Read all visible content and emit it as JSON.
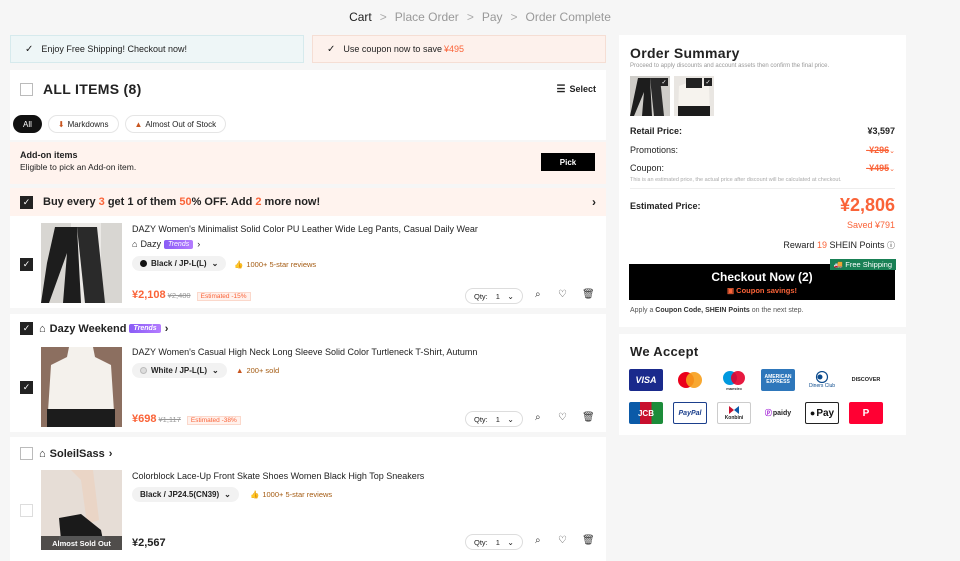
{
  "breadcrumb": [
    "Cart",
    "Place Order",
    "Pay",
    "Order Complete"
  ],
  "banners": {
    "shipping": "Enjoy Free Shipping! Checkout now!",
    "coupon_text": "Use coupon now to save",
    "coupon_amount": "¥495"
  },
  "cart": {
    "title": "ALL ITEMS (8)",
    "select_label": "Select",
    "filters": [
      "All",
      "Markdowns",
      "Almost Out of Stock"
    ],
    "addon": {
      "title": "Add-on items",
      "desc": "Eligible to pick an Add-on item.",
      "button": "Pick"
    },
    "promo": {
      "p1": "Buy every ",
      "n1": "3",
      "p2": " get 1 of them ",
      "n2": "50",
      "p3": "% OFF. Add ",
      "n3": "2",
      "p4": " more now!"
    },
    "items": [
      {
        "name": "DAZY Women's Minimalist Solid Color PU Leather Wide Leg Pants, Casual Daily Wear",
        "store": "Dazy",
        "trends": "Trends",
        "attr": "Black / JP-L(L)",
        "badge": "1000+ 5-star reviews",
        "price": "¥2,108",
        "old": "¥2,480",
        "est": "Estimated -15%",
        "qty_label": "Qty:",
        "qty": "1"
      },
      {
        "store_header": "Dazy Weekend",
        "trends": "Trends",
        "name": "DAZY Women's Casual High Neck Long Sleeve Solid Color Turtleneck T-Shirt, Autumn",
        "attr": "White / JP-L(L)",
        "badge": "200+ sold",
        "price": "¥698",
        "old": "¥1,117",
        "est": "Estimated -38%",
        "qty_label": "Qty:",
        "qty": "1"
      },
      {
        "store_header": "SoleilSass",
        "name": "Colorblock Lace-Up Front Skate Shoes Women Black High Top Sneakers",
        "attr": "Black / JP24.5(CN39)",
        "badge": "1000+ 5-star reviews",
        "overlay": "Almost Sold Out",
        "price": "¥2,567",
        "qty_label": "Qty:",
        "qty": "1"
      }
    ]
  },
  "summary": {
    "title": "Order Summary",
    "sub": "Proceed to apply discounts and account assets then confirm the final price.",
    "retail_label": "Retail Price:",
    "retail": "¥3,597",
    "promotions_label": "Promotions:",
    "promotions": "-¥296",
    "coupon_label": "Coupon:",
    "coupon": "-¥495",
    "note": "This is an estimated price, the actual price after discount will be calculated at checkout.",
    "estimated_label": "Estimated Price:",
    "estimated": "¥2,806",
    "saved": "Saved ¥791",
    "reward_pre": "Reward ",
    "reward_n": "19",
    "reward_post": " SHEIN Points",
    "checkout": "Checkout Now (2)",
    "checkout_sub": "Coupon savings!",
    "free_shipping": "Free Shipping",
    "apply_1": "Apply a ",
    "apply_b1": "Coupon Code, SHEIN Points",
    "apply_2": " on the next step."
  },
  "accept": {
    "title": "We Accept",
    "methods": [
      "VISA",
      "Mastercard",
      "Maestro",
      "AMERICAN EXPRESS",
      "Diners Club",
      "DISCOVER",
      "JCB",
      "PayPal",
      "Konbini",
      "paidy",
      "Pay",
      "PayPay"
    ]
  },
  "colors": {
    "accent": "#fa6338",
    "trends": "#8a5cf6",
    "free_ship": "#198055"
  }
}
